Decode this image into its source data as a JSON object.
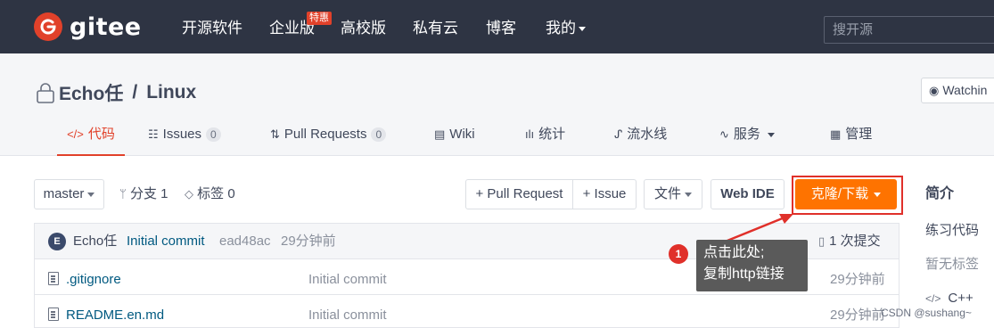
{
  "nav": {
    "logo_text": "gitee",
    "items": [
      "开源软件",
      "企业版",
      "高校版",
      "私有云",
      "博客",
      "我的"
    ],
    "hot_badge": "特惠",
    "search_placeholder": "搜开源"
  },
  "repo": {
    "owner": "Echo任",
    "separator": "/",
    "name": "Linux",
    "watch_label": "Watchin"
  },
  "tabs": [
    {
      "icon": "</>",
      "label": "代码"
    },
    {
      "icon": "☷",
      "label": "Issues",
      "count": "0"
    },
    {
      "icon": "⇅",
      "label": "Pull Requests",
      "count": "0"
    },
    {
      "icon": "▤",
      "label": "Wiki"
    },
    {
      "icon": "ılı",
      "label": "统计"
    },
    {
      "icon": "ᔑ",
      "label": "流水线"
    },
    {
      "icon": "∿",
      "label": "服务"
    },
    {
      "icon": "▦",
      "label": "管理"
    }
  ],
  "toolbar": {
    "branch": "master",
    "branches": "分支 1",
    "tags": "标签 0",
    "pull_request": "+ Pull Request",
    "issue": "+ Issue",
    "file": "文件",
    "web_ide": "Web IDE",
    "clone": "克隆/下载"
  },
  "commit": {
    "avatar_letter": "E",
    "author": "Echo任",
    "message": "Initial commit",
    "hash": "ead48ac",
    "time": "29分钟前",
    "total": "1 次提交"
  },
  "files": [
    {
      "name": ".gitignore",
      "message": "Initial commit",
      "time": "29分钟前"
    },
    {
      "name": "README.en.md",
      "message": "Initial commit",
      "time": "29分钟前"
    }
  ],
  "sidebar": {
    "title": "简介",
    "description": "练习代码",
    "tags": "暂无标签",
    "language": "C++"
  },
  "annotation": {
    "number": "1",
    "line1": "点击此处;",
    "line2": "复制http链接"
  },
  "watermark": "CSDN @sushang~",
  "colors": {
    "nav_bg": "#2e3443",
    "brand_red": "#e1412a",
    "clone_orange": "#fe7300",
    "link_blue": "#005980"
  }
}
